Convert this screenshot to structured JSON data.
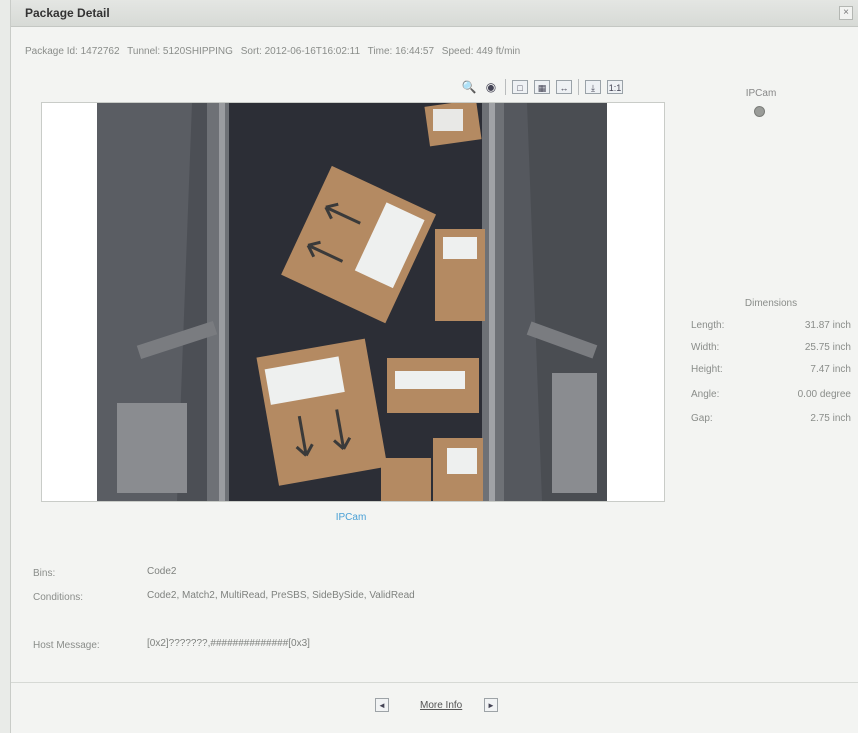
{
  "dialog": {
    "title": "Package Detail",
    "close_glyph": "×"
  },
  "info": {
    "package_id": "Package Id: 1472762",
    "tunnel": "Tunnel: 5120SHIPPING",
    "sort": "Sort: 2012-06-16T16:02:11",
    "time": "Time: 16:44:57",
    "speed": "Speed: 449 ft/min"
  },
  "toolbar": {
    "icons": [
      "zoom-icon",
      "eye-icon",
      "fit-icon",
      "grid-icon",
      "arrows-icon",
      "download-icon",
      "ratio-icon"
    ],
    "zoom_glyph": "🔍",
    "eye_glyph": "◉",
    "fit_glyph": "□",
    "grid_glyph": "▦",
    "arrows_glyph": "↔",
    "download_glyph": "⤓",
    "ratio_glyph": "1:1"
  },
  "camera": {
    "label": "IPCam",
    "side_label": "IPCam"
  },
  "dimensions": {
    "title": "Dimensions",
    "rows": [
      {
        "label": "Length:",
        "value": "31.87 inch"
      },
      {
        "label": "Width:",
        "value": "25.75 inch"
      },
      {
        "label": "Height:",
        "value": "7.47 inch"
      },
      {
        "label": "Angle:",
        "value": "0.00 degree"
      },
      {
        "label": "Gap:",
        "value": "2.75 inch"
      }
    ]
  },
  "details": {
    "bins_label": "Bins:",
    "bins_value": "Code2",
    "conditions_label": "Conditions:",
    "conditions_value": "Code2, Match2, MultiRead, PreSBS, SideBySide, ValidRead",
    "host_label": "Host Message:",
    "host_value": "[0x2]???????,##############[0x3]"
  },
  "footer": {
    "prev_glyph": "◄",
    "more_info": "More Info",
    "next_glyph": "►"
  },
  "colors": {
    "accent_blue": "#4aa0d6",
    "dialog_bg": "#f3f4f2",
    "belt": "#2d2f37",
    "box": "#b48a62"
  }
}
